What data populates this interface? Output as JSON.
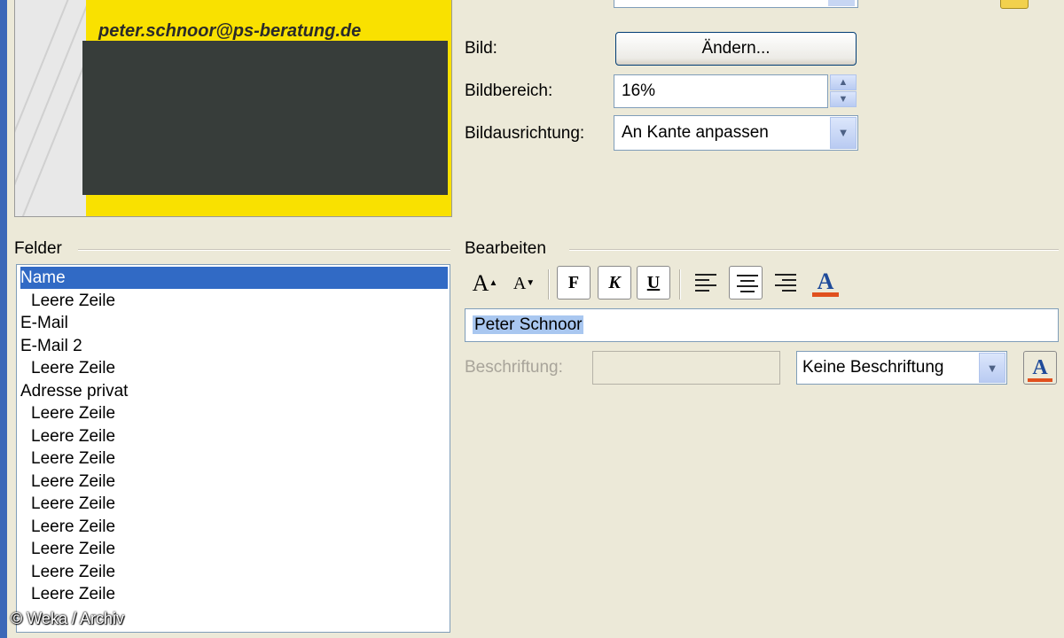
{
  "card": {
    "email": "peter.schnoor@ps-beratung.de"
  },
  "picture": {
    "label": "Bild:",
    "change_button": "Ändern...",
    "zoom_label": "Bildbereich:",
    "zoom_value": "16%",
    "align_label": "Bildausrichtung:",
    "align_value": "An Kante anpassen"
  },
  "fields": {
    "title": "Felder",
    "items": [
      {
        "label": "Name",
        "indent": false,
        "selected": true
      },
      {
        "label": "Leere Zeile",
        "indent": true
      },
      {
        "label": "E-Mail",
        "indent": false
      },
      {
        "label": "E-Mail 2",
        "indent": false
      },
      {
        "label": "Leere Zeile",
        "indent": true
      },
      {
        "label": "Adresse privat",
        "indent": false
      },
      {
        "label": "Leere Zeile",
        "indent": true
      },
      {
        "label": "Leere Zeile",
        "indent": true
      },
      {
        "label": "Leere Zeile",
        "indent": true
      },
      {
        "label": "Leere Zeile",
        "indent": true
      },
      {
        "label": "Leere Zeile",
        "indent": true
      },
      {
        "label": "Leere Zeile",
        "indent": true
      },
      {
        "label": "Leere Zeile",
        "indent": true
      },
      {
        "label": "Leere Zeile",
        "indent": true
      },
      {
        "label": "Leere Zeile",
        "indent": true
      }
    ]
  },
  "edit": {
    "title": "Bearbeiten",
    "toolbar": {
      "grow_font": "A",
      "shrink_font": "A",
      "bold": "F",
      "italic": "K",
      "underline": "U",
      "font_color": "A"
    },
    "value": "Peter Schnoor",
    "caption_label": "Beschriftung:",
    "caption_value": "",
    "caption_mode": "Keine Beschriftung"
  },
  "copyright": "© Weka / Archiv",
  "colors": {
    "selection": "#316ac5",
    "card_yellow": "#f9e100",
    "card_dark": "#373d3a",
    "font_color_underline": "#e0501e"
  }
}
